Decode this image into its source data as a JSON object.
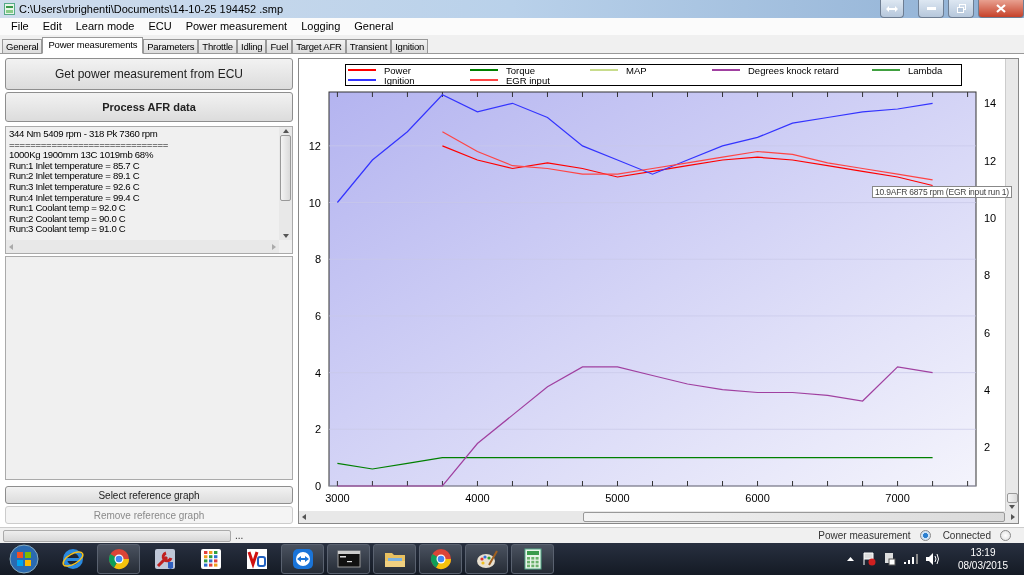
{
  "window": {
    "title": "C:\\Users\\rbrighenti\\Documents\\14-10-25 194452 .smp"
  },
  "menu": [
    "File",
    "Edit",
    "Learn mode",
    "ECU",
    "Power measurement",
    "Logging",
    "General"
  ],
  "tabs": [
    {
      "label": "General",
      "selected": false
    },
    {
      "label": "Power measurements",
      "selected": true
    },
    {
      "label": "Parameters",
      "selected": false
    },
    {
      "label": "Throttle",
      "selected": false
    },
    {
      "label": "Idling",
      "selected": false
    },
    {
      "label": "Fuel",
      "selected": false
    },
    {
      "label": "Target AFR",
      "selected": false
    },
    {
      "label": "Transient",
      "selected": false
    },
    {
      "label": "Ignition",
      "selected": false
    }
  ],
  "left_panel": {
    "buttons": [
      {
        "label": "Get power measurement from ECU",
        "bold": false,
        "disabled": false
      },
      {
        "label": "Process AFR data",
        "bold": true,
        "disabled": false
      }
    ],
    "log": [
      "344 Nm 5409 rpm - 318 Pk 7360 rpm",
      "==============================",
      "1000Kg 1900mm 13C 1019mb 68%",
      "Run:1 Inlet temperature = 85.7 C",
      "Run:2 Inlet temperature = 89.1 C",
      "Run:3 Inlet temperature = 92.6 C",
      "Run:4 Inlet temperature = 99.4 C",
      "Run:1 Coolant temp = 92.0 C",
      "Run:2 Coolant temp = 90.0 C",
      "Run:3 Coolant temp = 91.0 C"
    ],
    "bottom_buttons": [
      {
        "label": "Select reference graph",
        "disabled": false
      },
      {
        "label": "Remove reference graph",
        "disabled": true
      }
    ]
  },
  "chart": {
    "tooltip": "10.9AFR 6875 rpm (EGR input run 1)",
    "right_axis": {
      "ticks": [
        "14",
        "12",
        "10",
        "8",
        "6",
        "4",
        "2"
      ]
    },
    "chart_data": {
      "type": "line",
      "grid": true,
      "xlim": [
        2940,
        7560
      ],
      "ylim": [
        0,
        13.9
      ],
      "xticks": [
        3000,
        4000,
        5000,
        6000,
        7000
      ],
      "yticks": [
        0,
        2,
        4,
        6,
        8,
        10,
        12
      ],
      "x": [
        3000,
        3250,
        3500,
        3750,
        4000,
        4250,
        4500,
        4750,
        5000,
        5250,
        5500,
        5750,
        6000,
        6250,
        6500,
        6750,
        7000,
        7250
      ],
      "series": [
        {
          "name": "Power",
          "color": "#ff0000",
          "values": [
            null,
            null,
            null,
            12,
            11.5,
            11.2,
            11.4,
            11.2,
            10.9,
            11.1,
            11.3,
            11.5,
            11.6,
            11.5,
            11.3,
            11.1,
            10.9,
            10.6
          ]
        },
        {
          "name": "Ignition",
          "color": "#3333ff",
          "values": [
            10,
            11.5,
            12.5,
            13.8,
            13.2,
            13.5,
            13,
            12,
            11.5,
            11,
            11.5,
            12,
            12.3,
            12.8,
            13,
            13.2,
            13.3,
            13.5
          ]
        },
        {
          "name": "Torque",
          "color": "#008000",
          "values": [
            0.8,
            0.6,
            0.8,
            1,
            1,
            1,
            1,
            1,
            1,
            1,
            1,
            1,
            1,
            1,
            1,
            1,
            1,
            1
          ]
        },
        {
          "name": "EGR input",
          "color": "#ff4444",
          "values": [
            null,
            null,
            null,
            12.5,
            11.8,
            11.3,
            11.2,
            11,
            11,
            11.2,
            11.4,
            11.6,
            11.8,
            11.7,
            11.4,
            11.2,
            11,
            10.8
          ]
        },
        {
          "name": "MAP",
          "color": "#c8dc8c",
          "values": [
            null,
            null,
            null,
            null,
            null,
            null,
            null,
            null,
            null,
            null,
            null,
            null,
            null,
            null,
            null,
            null,
            null,
            null
          ]
        },
        {
          "name": "Degrees knock retard",
          "color": "#a040a0",
          "values": [
            0,
            0,
            0,
            0,
            1.5,
            2.5,
            3.5,
            4.2,
            4.2,
            3.9,
            3.6,
            3.4,
            3.3,
            3.3,
            3.2,
            3,
            4.2,
            4
          ]
        },
        {
          "name": "Lambda",
          "color": "#40a040",
          "values": [
            null,
            null,
            null,
            null,
            null,
            null,
            null,
            null,
            null,
            null,
            null,
            null,
            null,
            null,
            null,
            null,
            null,
            null
          ]
        }
      ]
    }
  },
  "status_bar": {
    "progress": {
      "level": 0
    },
    "ellipsis": "...",
    "radios": [
      {
        "label": "Power measurement",
        "selected": true
      },
      {
        "label": "Connected",
        "selected": false
      }
    ]
  },
  "taskbar": {
    "items": [
      {
        "kind": "ie",
        "running": false
      },
      {
        "kind": "chrome",
        "running": true
      },
      {
        "kind": "wrench",
        "running": false
      },
      {
        "kind": "grid",
        "running": false
      },
      {
        "kind": "remote",
        "running": false
      },
      {
        "kind": "teamviewer",
        "running": true
      },
      {
        "kind": "console",
        "running": true
      },
      {
        "kind": "folder",
        "running": true
      },
      {
        "kind": "chrome",
        "running": true
      },
      {
        "kind": "paint",
        "running": true
      },
      {
        "kind": "sheet",
        "running": true
      }
    ],
    "time": "13:19",
    "date": "08/03/2015"
  }
}
